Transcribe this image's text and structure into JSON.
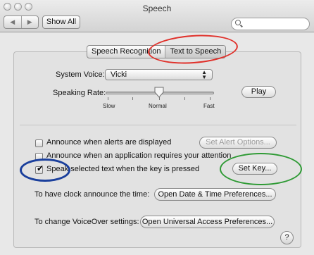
{
  "window": {
    "title": "Speech"
  },
  "toolbar": {
    "back_icon": "back-arrow-icon",
    "forward_icon": "forward-arrow-icon",
    "show_all_label": "Show All",
    "search_placeholder": ""
  },
  "tabs": [
    {
      "label": "Speech Recognition",
      "active": false
    },
    {
      "label": "Text to Speech",
      "active": true
    }
  ],
  "voice": {
    "label": "System Voice:",
    "value": "Vicki"
  },
  "rate": {
    "label": "Speaking Rate:",
    "slow": "Slow",
    "normal": "Normal",
    "fast": "Fast",
    "play_label": "Play",
    "level": 0.45
  },
  "options": [
    {
      "label": "Announce when alerts are displayed",
      "checked": false
    },
    {
      "label": "Announce when an application requires your attention",
      "checked": false
    },
    {
      "label": "Speak selected text when the key is pressed",
      "checked": true
    }
  ],
  "set_alert_options_label": "Set Alert Options...",
  "set_key_label": "Set Key...",
  "clock": {
    "label": "To have clock announce the time:",
    "button_label": "Open Date & Time Preferences..."
  },
  "voiceover": {
    "label": "To change VoiceOver settings:",
    "button_label": "Open Universal Access Preferences..."
  },
  "help_label": "?",
  "annotation_colors": {
    "red": "#e0302a",
    "blue": "#1a3f9c",
    "green": "#2e9a34"
  }
}
